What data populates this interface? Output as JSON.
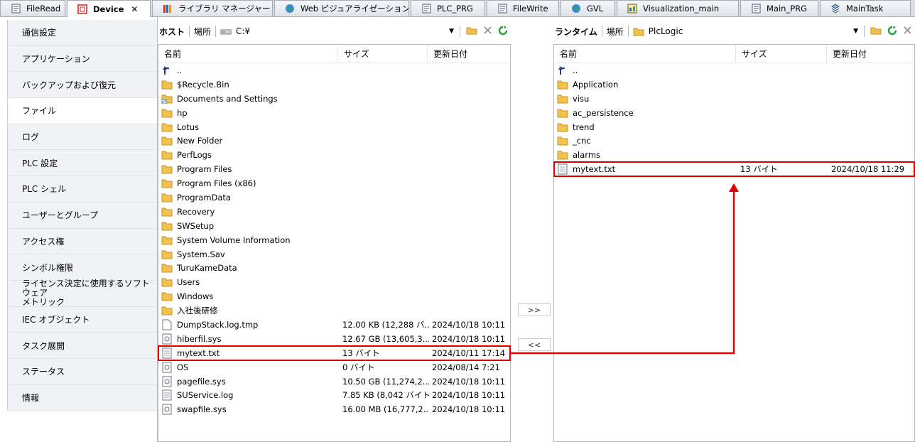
{
  "tabs": [
    {
      "label": "FileRead",
      "icon": "document-icon"
    },
    {
      "label": "Device",
      "icon": "device-icon",
      "active": true,
      "close": "✕"
    },
    {
      "label": "ライブラリ マネージャー",
      "icon": "library-icon"
    },
    {
      "label": "Web ビジュアライゼーション",
      "icon": "globe-icon"
    },
    {
      "label": "PLC_PRG",
      "icon": "document-icon"
    },
    {
      "label": "FileWrite",
      "icon": "document-icon"
    },
    {
      "label": "GVL",
      "icon": "globe-icon"
    },
    {
      "label": "Visualization_main",
      "icon": "visualization-icon"
    },
    {
      "label": "Main_PRG",
      "icon": "document-icon"
    },
    {
      "label": "MainTask",
      "icon": "task-icon"
    }
  ],
  "nav": {
    "items": [
      "通信設定",
      "アプリケーション",
      "バックアップおよび復元",
      "ファイル",
      "ログ",
      "PLC 設定",
      "PLC シェル",
      "ユーザーとグループ",
      "アクセス権",
      "シンボル権限",
      "ライセンス決定に使用するソフトウェア\nメトリック",
      "IEC オブジェクト",
      "タスク展開",
      "ステータス",
      "情報"
    ],
    "active_index": 3
  },
  "host": {
    "label": "ホスト",
    "location_label": "場所",
    "path": "C:¥",
    "columns": {
      "name": "名前",
      "size": "サイズ",
      "date": "更新日付"
    },
    "files": [
      {
        "name": "..",
        "icon": "up-arrow-icon",
        "size": "",
        "date": ""
      },
      {
        "name": "$Recycle.Bin",
        "icon": "folder-icon",
        "size": "",
        "date": ""
      },
      {
        "name": "Documents and Settings",
        "icon": "shortcut-icon",
        "size": "",
        "date": ""
      },
      {
        "name": "hp",
        "icon": "folder-icon",
        "size": "",
        "date": ""
      },
      {
        "name": "Lotus",
        "icon": "folder-icon",
        "size": "",
        "date": ""
      },
      {
        "name": "New Folder",
        "icon": "folder-icon",
        "size": "",
        "date": ""
      },
      {
        "name": "PerfLogs",
        "icon": "folder-icon",
        "size": "",
        "date": ""
      },
      {
        "name": "Program Files",
        "icon": "folder-icon",
        "size": "",
        "date": ""
      },
      {
        "name": "Program Files (x86)",
        "icon": "folder-icon",
        "size": "",
        "date": ""
      },
      {
        "name": "ProgramData",
        "icon": "folder-icon",
        "size": "",
        "date": ""
      },
      {
        "name": "Recovery",
        "icon": "folder-icon",
        "size": "",
        "date": ""
      },
      {
        "name": "SWSetup",
        "icon": "folder-icon",
        "size": "",
        "date": ""
      },
      {
        "name": "System Volume Information",
        "icon": "folder-icon",
        "size": "",
        "date": ""
      },
      {
        "name": "System.Sav",
        "icon": "folder-icon",
        "size": "",
        "date": ""
      },
      {
        "name": "TuruKameData",
        "icon": "folder-icon",
        "size": "",
        "date": ""
      },
      {
        "name": "Users",
        "icon": "folder-icon",
        "size": "",
        "date": ""
      },
      {
        "name": "Windows",
        "icon": "folder-icon",
        "size": "",
        "date": ""
      },
      {
        "name": "入社後研修",
        "icon": "folder-icon",
        "size": "",
        "date": ""
      },
      {
        "name": "DumpStack.log.tmp",
        "icon": "file-icon",
        "size": "12.00 KB (12,288 バ...",
        "date": "2024/10/18 10:11"
      },
      {
        "name": "hiberfil.sys",
        "icon": "system-file-icon",
        "size": "12.67 GB (13,605,3...",
        "date": "2024/10/18 10:11"
      },
      {
        "name": "mytext.txt",
        "icon": "text-file-icon",
        "size": "13 バイト",
        "date": "2024/10/11 17:14",
        "highlight": true
      },
      {
        "name": "OS",
        "icon": "system-file-icon",
        "size": "0 バイト",
        "date": "2024/08/14 7:21"
      },
      {
        "name": "pagefile.sys",
        "icon": "system-file-icon",
        "size": "10.50 GB (11,274,2...",
        "date": "2024/10/18 10:11"
      },
      {
        "name": "SUService.log",
        "icon": "text-file-icon",
        "size": "7.85 KB (8,042 バイト)",
        "date": "2024/10/18 10:11"
      },
      {
        "name": "swapfile.sys",
        "icon": "system-file-icon",
        "size": "16.00 MB (16,777,2...",
        "date": "2024/10/18 10:11"
      }
    ]
  },
  "runtime": {
    "label": "ランタイム",
    "location_label": "場所",
    "path": "PlcLogic",
    "columns": {
      "name": "名前",
      "size": "サイズ",
      "date": "更新日付"
    },
    "files": [
      {
        "name": "..",
        "icon": "up-arrow-icon",
        "size": "",
        "date": ""
      },
      {
        "name": "Application",
        "icon": "folder-icon",
        "size": "",
        "date": ""
      },
      {
        "name": "visu",
        "icon": "folder-icon",
        "size": "",
        "date": ""
      },
      {
        "name": "ac_persistence",
        "icon": "folder-icon",
        "size": "",
        "date": ""
      },
      {
        "name": "trend",
        "icon": "folder-icon",
        "size": "",
        "date": ""
      },
      {
        "name": "_cnc",
        "icon": "folder-icon",
        "size": "",
        "date": ""
      },
      {
        "name": "alarms",
        "icon": "folder-icon",
        "size": "",
        "date": ""
      },
      {
        "name": "mytext.txt",
        "icon": "text-file-icon",
        "size": "13 バイト",
        "date": "2024/10/18 11:29",
        "highlight": true
      }
    ]
  },
  "transfer": {
    "to_runtime": ">>",
    "to_host": "<<"
  },
  "colors": {
    "highlight": "#e00000",
    "folder": "#f2c14e",
    "refresh": "#22a03a"
  }
}
